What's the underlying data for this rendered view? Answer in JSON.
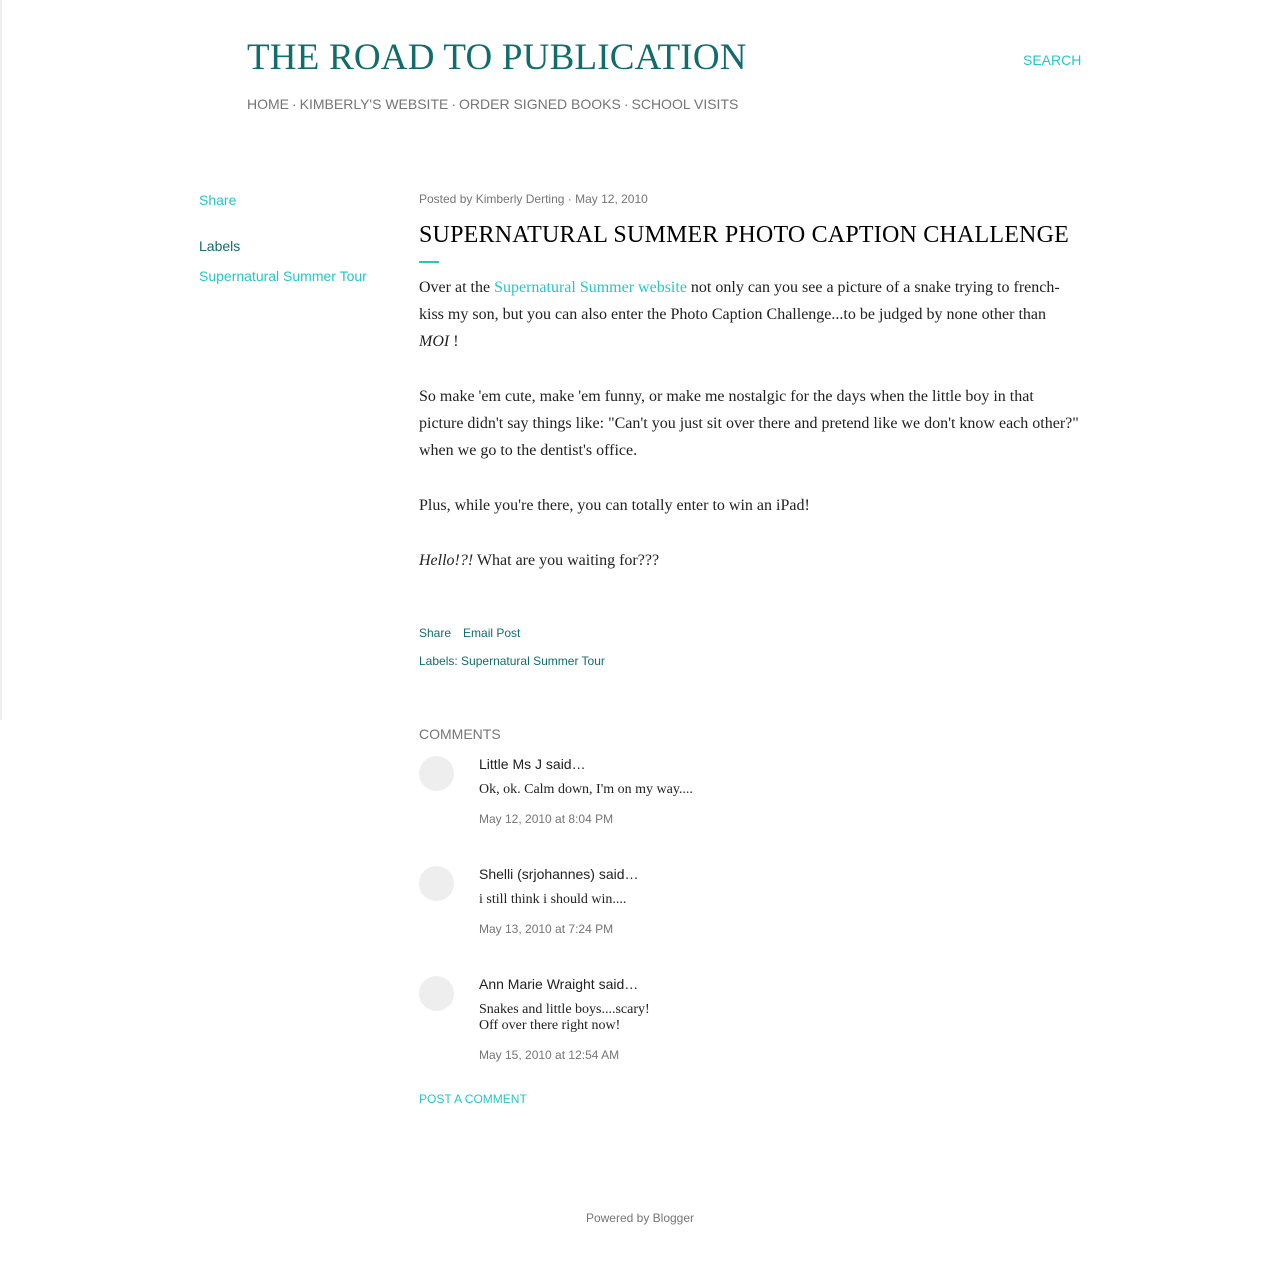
{
  "header": {
    "blog_title": "THE ROAD TO PUBLICATION",
    "search_label": "SEARCH",
    "nav": [
      "HOME",
      "KIMBERLY'S WEBSITE",
      "ORDER SIGNED BOOKS",
      "SCHOOL VISITS"
    ],
    "nav_separator": "·"
  },
  "sidebar": {
    "share_label": "Share",
    "labels_title": "Labels",
    "label_link": "Supernatural Summer Tour"
  },
  "post": {
    "meta_prefix": "Posted by",
    "author": "Kimberly Derting",
    "meta_sep": "·",
    "date": "May 12, 2010",
    "title": "SUPERNATURAL SUMMER PHOTO CAPTION CHALLENGE",
    "p1_before": "Over at the ",
    "p1_link": "Supernatural Summer website",
    "p1_after": " not only can you see a picture of a snake trying to french-kiss my son, but you can also enter the Photo Caption Challenge...to be judged by none other than ",
    "p1_em": "MOI",
    "p1_end": " !",
    "p2": "So make 'em cute, make 'em funny, or make me nostalgic for the days when the little boy in that picture didn't say things like: \"Can't you just sit over there and pretend like we don't know each other?\" when we go to the dentist's office.",
    "p3": "Plus, while you're there, you can totally enter to win an iPad!",
    "p4_em": "Hello!?!",
    "p4_rest": " What are you waiting for???",
    "share_label": "Share",
    "email_label": "Email Post",
    "labels_prefix": "Labels:",
    "label_link": "Supernatural Summer Tour"
  },
  "comments": {
    "title": "COMMENTS",
    "items": [
      {
        "author": "Little Ms J said…",
        "lines": [
          "Ok, ok. Calm down, I'm on my way...."
        ],
        "date": "May 12, 2010 at 8:04 PM"
      },
      {
        "author": "Shelli (srjohannes) said…",
        "lines": [
          "i still think i should win...."
        ],
        "date": "May 13, 2010 at 7:24 PM"
      },
      {
        "author": "Ann Marie Wraight said…",
        "lines": [
          "Snakes and little boys....scary!",
          "Off over there right now!"
        ],
        "date": "May 15, 2010 at 12:54 AM"
      }
    ],
    "post_comment_label": "POST A COMMENT"
  },
  "footer": {
    "powered_by": "Powered by Blogger"
  }
}
